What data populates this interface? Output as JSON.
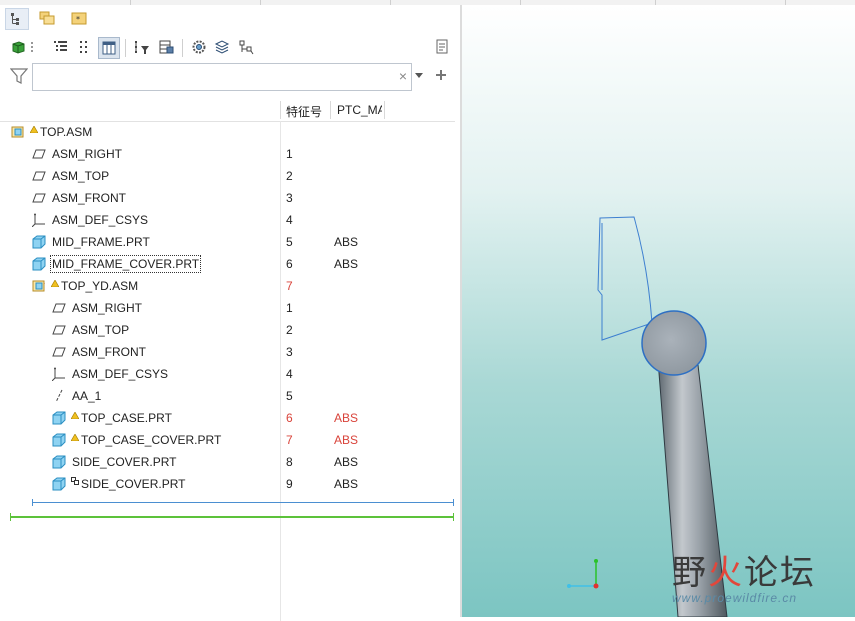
{
  "header": {
    "col_feature_id": "特征号",
    "col_ptc": "PTC_MA"
  },
  "search": {
    "value": "",
    "clear": "×"
  },
  "tree": [
    {
      "label": "TOP.ASM",
      "num": "",
      "ptc": "",
      "icon": "assembly-icon",
      "warn": true,
      "expand": ""
    },
    {
      "label": "ASM_RIGHT",
      "num": "1",
      "ptc": "",
      "icon": "datum-plane-icon"
    },
    {
      "label": "ASM_TOP",
      "num": "2",
      "ptc": "",
      "icon": "datum-plane-icon"
    },
    {
      "label": "ASM_FRONT",
      "num": "3",
      "ptc": "",
      "icon": "datum-plane-icon"
    },
    {
      "label": "ASM_DEF_CSYS",
      "num": "4",
      "ptc": "",
      "icon": "csys-icon"
    },
    {
      "label": "MID_FRAME.PRT",
      "num": "5",
      "ptc": "ABS",
      "icon": "part-icon",
      "expand": "collapsed"
    },
    {
      "label": "MID_FRAME_COVER.PRT",
      "num": "6",
      "ptc": "ABS",
      "icon": "part-icon",
      "expand": "collapsed",
      "focus": true
    },
    {
      "label": "TOP_YD.ASM",
      "num": "7",
      "ptc": "",
      "icon": "assembly-icon",
      "warn": true,
      "expand": "expanded",
      "red": true
    },
    {
      "label": "ASM_RIGHT",
      "num": "1",
      "ptc": "",
      "icon": "datum-plane-icon"
    },
    {
      "label": "ASM_TOP",
      "num": "2",
      "ptc": "",
      "icon": "datum-plane-icon"
    },
    {
      "label": "ASM_FRONT",
      "num": "3",
      "ptc": "",
      "icon": "datum-plane-icon"
    },
    {
      "label": "ASM_DEF_CSYS",
      "num": "4",
      "ptc": "",
      "icon": "csys-icon"
    },
    {
      "label": "AA_1",
      "num": "5",
      "ptc": "",
      "icon": "axis-icon"
    },
    {
      "label": "TOP_CASE.PRT",
      "num": "6",
      "ptc": "ABS",
      "icon": "part-icon",
      "warn": true,
      "expand": "collapsed-red",
      "red": true
    },
    {
      "label": "TOP_CASE_COVER.PRT",
      "num": "7",
      "ptc": "ABS",
      "icon": "part-icon",
      "warn": true,
      "expand": "collapsed-red",
      "red": true
    },
    {
      "label": "SIDE_COVER.PRT",
      "num": "8",
      "ptc": "ABS",
      "icon": "part-icon",
      "expand": "collapsed"
    },
    {
      "label": "SIDE_COVER.PRT",
      "num": "9",
      "ptc": "ABS",
      "icon": "part-icon",
      "expand": "collapsed",
      "inherit": true
    }
  ],
  "watermark": {
    "cn_a": "野",
    "cn_b": "火",
    "cn_c": "论坛",
    "url": "www.proewildfire.cn"
  },
  "colors": {
    "accent_red": "#d9433a",
    "insert_line": "#4b8fd1",
    "green_line": "#5cc23a",
    "part_cyan": "#33aadd"
  }
}
